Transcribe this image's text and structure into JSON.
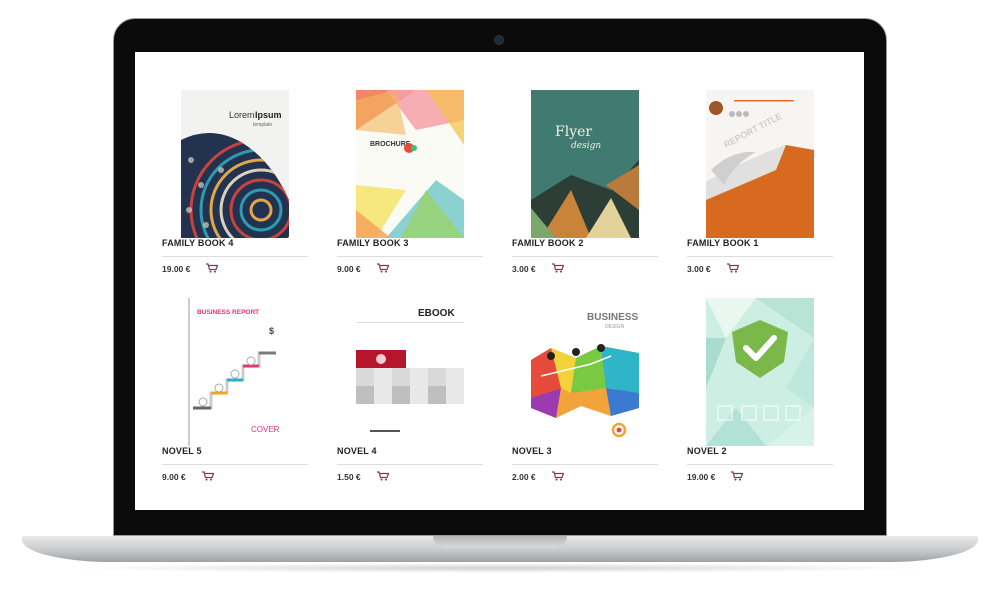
{
  "products": [
    {
      "title": "FAMILY BOOK 4",
      "price": "19.00 €",
      "cover": "mandala",
      "cover_text": "Lorem",
      "cover_text_bold": "Ipsum",
      "cover_sub": "template"
    },
    {
      "title": "FAMILY BOOK 3",
      "price": "9.00 €",
      "cover": "brochure",
      "cover_text": "BROCHURE"
    },
    {
      "title": "FAMILY BOOK 2",
      "price": "3.00 €",
      "cover": "flyer",
      "cover_text": "Flyer",
      "cover_sub": "design"
    },
    {
      "title": "FAMILY BOOK 1",
      "price": "3.00 €",
      "cover": "report",
      "cover_text": "REPORT TITLE"
    },
    {
      "title": "NOVEL 5",
      "price": "9.00 €",
      "cover": "business-report",
      "cover_text": "BUSINESS REPORT",
      "cover_sub": "COVER"
    },
    {
      "title": "NOVEL 4",
      "price": "1.50 €",
      "cover": "ebook",
      "cover_text": "EBOOK"
    },
    {
      "title": "NOVEL 3",
      "price": "2.00 €",
      "cover": "business-design",
      "cover_text": "BUSINESS",
      "cover_sub": "DESIGN"
    },
    {
      "title": "NOVEL 2",
      "price": "19.00 €",
      "cover": "checkmark"
    }
  ],
  "colors": {
    "accent": "#8a2a5a",
    "cart": "#7b3a5c",
    "bezel": "#0b0b0b"
  }
}
